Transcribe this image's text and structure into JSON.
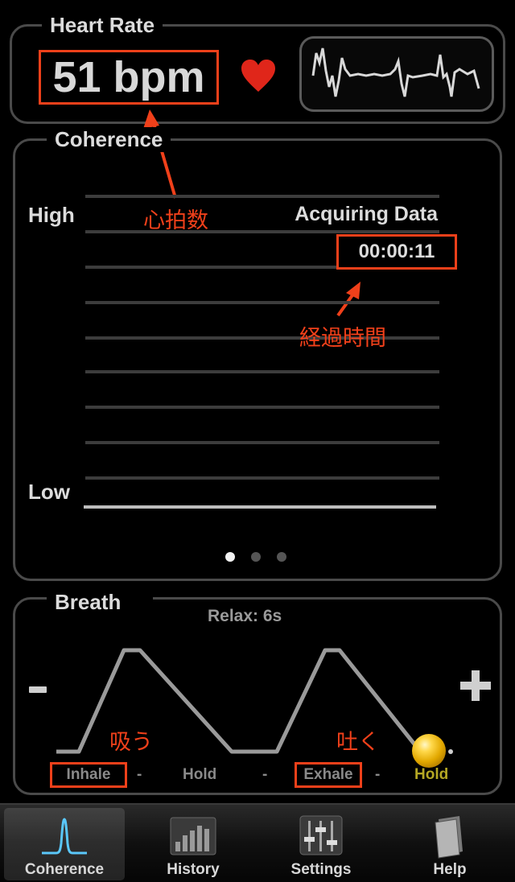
{
  "heart_rate": {
    "title": "Heart Rate",
    "value": "51 bpm",
    "annotation": "心拍数"
  },
  "coherence": {
    "title": "Coherence",
    "high_label": "High",
    "low_label": "Low",
    "status": "Acquiring Data",
    "timer": "00:00:11",
    "timer_annotation": "経過時間",
    "page_count": 3,
    "current_page": 1
  },
  "breath": {
    "title": "Breath",
    "relax": "Relax: 6s",
    "minus_label": "-",
    "plus_label": "+",
    "inhale_annotation": "吸う",
    "exhale_annotation": "吐く",
    "phases": [
      "Inhale",
      "Hold",
      "Exhale",
      "Hold"
    ],
    "separator": "-",
    "active_phase": "Hold"
  },
  "tabs": [
    {
      "label": "Coherence",
      "icon": "coherence-peak-icon",
      "selected": true
    },
    {
      "label": "History",
      "icon": "history-bars-icon",
      "selected": false
    },
    {
      "label": "Settings",
      "icon": "settings-sliders-icon",
      "selected": false
    },
    {
      "label": "Help",
      "icon": "help-book-icon",
      "selected": false
    }
  ],
  "colors": {
    "annotation": "#f0401a",
    "heart": "#e0261a",
    "active_phase": "#b5a824",
    "coherence_tab_icon": "#5ac8fa"
  }
}
